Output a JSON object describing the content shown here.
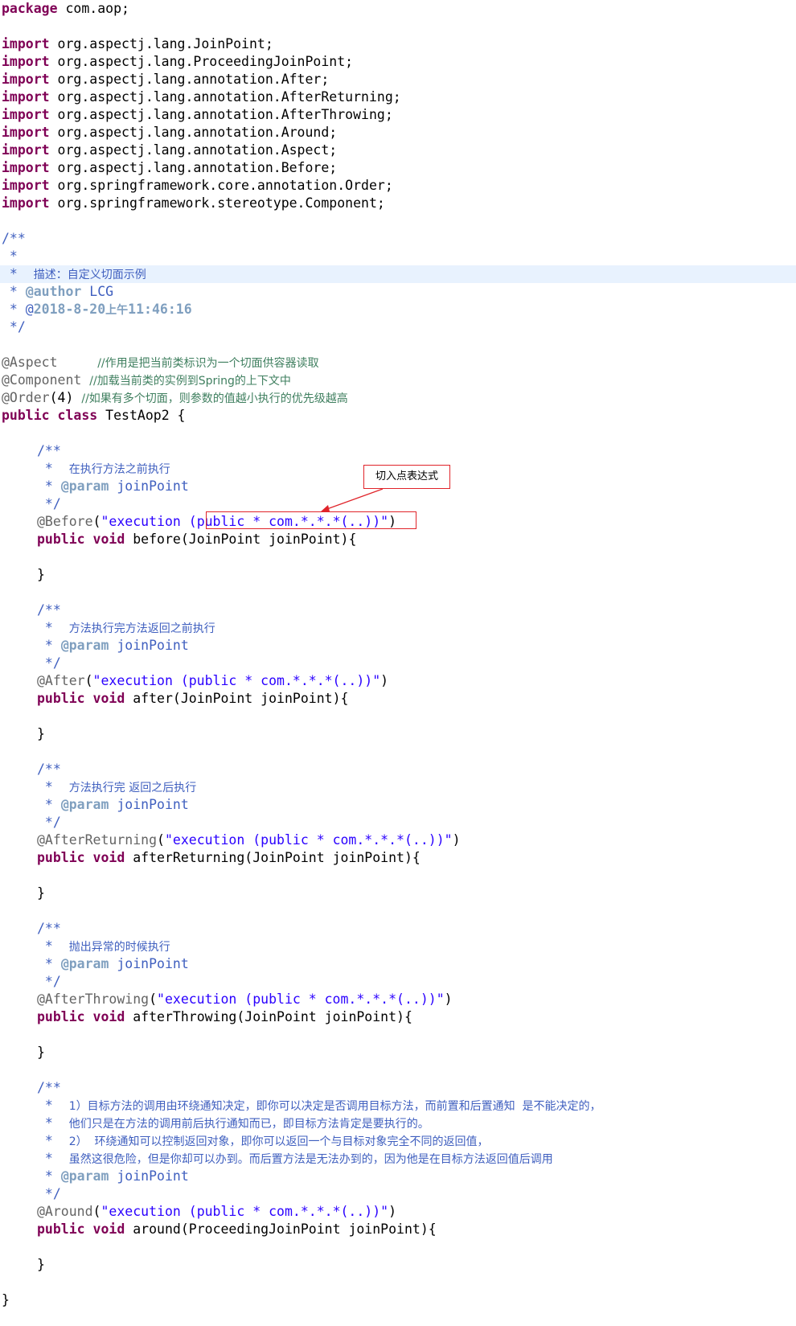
{
  "editor": {
    "lines": [
      {
        "indent": 0,
        "tokens": [
          {
            "t": "package",
            "c": "kw"
          },
          {
            "t": " com.aop;"
          }
        ]
      },
      {
        "indent": 0,
        "tokens": []
      },
      {
        "indent": 0,
        "tokens": [
          {
            "t": "import",
            "c": "kw"
          },
          {
            "t": " org.aspectj.lang.JoinPoint;"
          }
        ]
      },
      {
        "indent": 0,
        "tokens": [
          {
            "t": "import",
            "c": "kw"
          },
          {
            "t": " org.aspectj.lang.ProceedingJoinPoint;"
          }
        ]
      },
      {
        "indent": 0,
        "tokens": [
          {
            "t": "import",
            "c": "kw"
          },
          {
            "t": " org.aspectj.lang.annotation.After;"
          }
        ]
      },
      {
        "indent": 0,
        "tokens": [
          {
            "t": "import",
            "c": "kw"
          },
          {
            "t": " org.aspectj.lang.annotation.AfterReturning;"
          }
        ]
      },
      {
        "indent": 0,
        "tokens": [
          {
            "t": "import",
            "c": "kw"
          },
          {
            "t": " org.aspectj.lang.annotation.AfterThrowing;"
          }
        ]
      },
      {
        "indent": 0,
        "tokens": [
          {
            "t": "import",
            "c": "kw"
          },
          {
            "t": " org.aspectj.lang.annotation.Around;"
          }
        ]
      },
      {
        "indent": 0,
        "tokens": [
          {
            "t": "import",
            "c": "kw"
          },
          {
            "t": " org.aspectj.lang.annotation.Aspect;"
          }
        ]
      },
      {
        "indent": 0,
        "tokens": [
          {
            "t": "import",
            "c": "kw"
          },
          {
            "t": " org.aspectj.lang.annotation.Before;"
          }
        ]
      },
      {
        "indent": 0,
        "tokens": [
          {
            "t": "import",
            "c": "kw"
          },
          {
            "t": " org.springframework.core.annotation.Order;"
          }
        ]
      },
      {
        "indent": 0,
        "tokens": [
          {
            "t": "import",
            "c": "kw"
          },
          {
            "t": " org.springframework.stereotype.Component;"
          }
        ]
      },
      {
        "indent": 0,
        "tokens": []
      },
      {
        "indent": 0,
        "tokens": [
          {
            "t": "/**",
            "c": "com"
          }
        ]
      },
      {
        "indent": 0,
        "tokens": [
          {
            "t": " *",
            "c": "com"
          }
        ]
      },
      {
        "indent": 0,
        "hl": true,
        "tokens": [
          {
            "t": " *  ",
            "c": "com"
          },
          {
            "t": "描述：自定义切面示例",
            "c": "com",
            "cjk": true
          }
        ]
      },
      {
        "indent": 0,
        "tokens": [
          {
            "t": " * ",
            "c": "com"
          },
          {
            "t": "@author",
            "c": "tag"
          },
          {
            "t": " LCG",
            "c": "com"
          }
        ]
      },
      {
        "indent": 0,
        "tokens": [
          {
            "t": " * @",
            "c": "com"
          },
          {
            "t": "2018-8-20",
            "c": "tag"
          },
          {
            "t": "上午",
            "c": "tag",
            "cjk": true
          },
          {
            "t": "11:46:16",
            "c": "tag"
          }
        ]
      },
      {
        "indent": 0,
        "tokens": [
          {
            "t": " */",
            "c": "com"
          }
        ]
      },
      {
        "indent": 0,
        "tokens": []
      },
      {
        "indent": 0,
        "tokens": [
          {
            "t": "@Aspect",
            "c": "ann"
          },
          {
            "t": "     "
          },
          {
            "t": "//作用是把当前类标识为一个切面供容器读取",
            "c": "lcom",
            "cjk": true
          }
        ]
      },
      {
        "indent": 0,
        "tokens": [
          {
            "t": "@Component",
            "c": "ann"
          },
          {
            "t": " "
          },
          {
            "t": "//加载当前类的实例到Spring的上下文中",
            "c": "lcom",
            "cjk": true
          }
        ]
      },
      {
        "indent": 0,
        "tokens": [
          {
            "t": "@Order",
            "c": "ann"
          },
          {
            "t": "(4) "
          },
          {
            "t": "//如果有多个切面，则参数的值越小执行的优先级越高",
            "c": "lcom",
            "cjk": true
          }
        ]
      },
      {
        "indent": 0,
        "tokens": [
          {
            "t": "public",
            "c": "kw"
          },
          {
            "t": " "
          },
          {
            "t": "class",
            "c": "kw"
          },
          {
            "t": " TestAop2 {"
          }
        ]
      },
      {
        "indent": 0,
        "tokens": []
      },
      {
        "indent": 1,
        "tokens": [
          {
            "t": "/**",
            "c": "com"
          }
        ]
      },
      {
        "indent": 1,
        "tokens": [
          {
            "t": " *  ",
            "c": "com"
          },
          {
            "t": "在执行方法之前执行",
            "c": "com",
            "cjk": true
          }
        ]
      },
      {
        "indent": 1,
        "tokens": [
          {
            "t": " * ",
            "c": "com"
          },
          {
            "t": "@param",
            "c": "tag"
          },
          {
            "t": " joinPoint",
            "c": "com"
          }
        ]
      },
      {
        "indent": 1,
        "tokens": [
          {
            "t": " */",
            "c": "com"
          }
        ]
      },
      {
        "indent": 1,
        "tokens": [
          {
            "t": "@Before",
            "c": "ann"
          },
          {
            "t": "("
          },
          {
            "t": "\"execution (public * com.*.*.*(..))\"",
            "c": "str"
          },
          {
            "t": ")"
          }
        ]
      },
      {
        "indent": 1,
        "tokens": [
          {
            "t": "public",
            "c": "kw"
          },
          {
            "t": " "
          },
          {
            "t": "void",
            "c": "kw"
          },
          {
            "t": " before(JoinPoint joinPoint){"
          }
        ]
      },
      {
        "indent": 0,
        "tokens": []
      },
      {
        "indent": 1,
        "tokens": [
          {
            "t": "}"
          }
        ]
      },
      {
        "indent": 0,
        "tokens": []
      },
      {
        "indent": 1,
        "tokens": [
          {
            "t": "/**",
            "c": "com"
          }
        ]
      },
      {
        "indent": 1,
        "tokens": [
          {
            "t": " *  ",
            "c": "com"
          },
          {
            "t": "方法执行完方法返回之前执行",
            "c": "com",
            "cjk": true
          }
        ]
      },
      {
        "indent": 1,
        "tokens": [
          {
            "t": " * ",
            "c": "com"
          },
          {
            "t": "@param",
            "c": "tag"
          },
          {
            "t": " joinPoint",
            "c": "com"
          }
        ]
      },
      {
        "indent": 1,
        "tokens": [
          {
            "t": " */",
            "c": "com"
          }
        ]
      },
      {
        "indent": 1,
        "tokens": [
          {
            "t": "@After",
            "c": "ann"
          },
          {
            "t": "("
          },
          {
            "t": "\"execution (public * com.*.*.*(..))\"",
            "c": "str"
          },
          {
            "t": ")"
          }
        ]
      },
      {
        "indent": 1,
        "tokens": [
          {
            "t": "public",
            "c": "kw"
          },
          {
            "t": " "
          },
          {
            "t": "void",
            "c": "kw"
          },
          {
            "t": " after(JoinPoint joinPoint){"
          }
        ]
      },
      {
        "indent": 0,
        "tokens": []
      },
      {
        "indent": 1,
        "tokens": [
          {
            "t": "}"
          }
        ]
      },
      {
        "indent": 0,
        "tokens": []
      },
      {
        "indent": 1,
        "tokens": [
          {
            "t": "/**",
            "c": "com"
          }
        ]
      },
      {
        "indent": 1,
        "tokens": [
          {
            "t": " *  ",
            "c": "com"
          },
          {
            "t": "方法执行完 返回之后执行",
            "c": "com",
            "cjk": true
          }
        ]
      },
      {
        "indent": 1,
        "tokens": [
          {
            "t": " * ",
            "c": "com"
          },
          {
            "t": "@param",
            "c": "tag"
          },
          {
            "t": " joinPoint",
            "c": "com"
          }
        ]
      },
      {
        "indent": 1,
        "tokens": [
          {
            "t": " */",
            "c": "com"
          }
        ]
      },
      {
        "indent": 1,
        "tokens": [
          {
            "t": "@AfterReturning",
            "c": "ann"
          },
          {
            "t": "("
          },
          {
            "t": "\"execution (public * com.*.*.*(..))\"",
            "c": "str"
          },
          {
            "t": ")"
          }
        ]
      },
      {
        "indent": 1,
        "tokens": [
          {
            "t": "public",
            "c": "kw"
          },
          {
            "t": " "
          },
          {
            "t": "void",
            "c": "kw"
          },
          {
            "t": " afterReturning(JoinPoint joinPoint){"
          }
        ]
      },
      {
        "indent": 0,
        "tokens": []
      },
      {
        "indent": 1,
        "tokens": [
          {
            "t": "}"
          }
        ]
      },
      {
        "indent": 0,
        "tokens": []
      },
      {
        "indent": 1,
        "tokens": [
          {
            "t": "/**",
            "c": "com"
          }
        ]
      },
      {
        "indent": 1,
        "tokens": [
          {
            "t": " *  ",
            "c": "com"
          },
          {
            "t": "抛出异常的时候执行",
            "c": "com",
            "cjk": true
          }
        ]
      },
      {
        "indent": 1,
        "tokens": [
          {
            "t": " * ",
            "c": "com"
          },
          {
            "t": "@param",
            "c": "tag"
          },
          {
            "t": " joinPoint",
            "c": "com"
          }
        ]
      },
      {
        "indent": 1,
        "tokens": [
          {
            "t": " */",
            "c": "com"
          }
        ]
      },
      {
        "indent": 1,
        "tokens": [
          {
            "t": "@AfterThrowing",
            "c": "ann"
          },
          {
            "t": "("
          },
          {
            "t": "\"execution (public * com.*.*.*(..))\"",
            "c": "str"
          },
          {
            "t": ")"
          }
        ]
      },
      {
        "indent": 1,
        "tokens": [
          {
            "t": "public",
            "c": "kw"
          },
          {
            "t": " "
          },
          {
            "t": "void",
            "c": "kw"
          },
          {
            "t": " afterThrowing(JoinPoint joinPoint){"
          }
        ]
      },
      {
        "indent": 0,
        "tokens": []
      },
      {
        "indent": 1,
        "tokens": [
          {
            "t": "}"
          }
        ]
      },
      {
        "indent": 0,
        "tokens": []
      },
      {
        "indent": 1,
        "tokens": [
          {
            "t": "/**",
            "c": "com"
          }
        ]
      },
      {
        "indent": 1,
        "tokens": [
          {
            "t": " *  ",
            "c": "com"
          },
          {
            "t": "1）目标方法的调用由环绕通知决定，即你可以决定是否调用目标方法，而前置和后置通知  是不能决定的，",
            "c": "com",
            "cjk": true
          }
        ]
      },
      {
        "indent": 1,
        "tokens": [
          {
            "t": " *  ",
            "c": "com"
          },
          {
            "t": "他们只是在方法的调用前后执行通知而已，即目标方法肯定是要执行的。",
            "c": "com",
            "cjk": true
          }
        ]
      },
      {
        "indent": 1,
        "tokens": [
          {
            "t": " *  ",
            "c": "com"
          },
          {
            "t": "2）  环绕通知可以控制返回对象，即你可以返回一个与目标对象完全不同的返回值，",
            "c": "com",
            "cjk": true
          }
        ]
      },
      {
        "indent": 1,
        "tokens": [
          {
            "t": " *  ",
            "c": "com"
          },
          {
            "t": "虽然这很危险，但是你却可以办到。而后置方法是无法办到的，因为他是在目标方法返回值后调用",
            "c": "com",
            "cjk": true
          }
        ]
      },
      {
        "indent": 1,
        "tokens": [
          {
            "t": " * ",
            "c": "com"
          },
          {
            "t": "@param",
            "c": "tag"
          },
          {
            "t": " joinPoint",
            "c": "com"
          }
        ]
      },
      {
        "indent": 1,
        "tokens": [
          {
            "t": " */",
            "c": "com"
          }
        ]
      },
      {
        "indent": 1,
        "tokens": [
          {
            "t": "@Around",
            "c": "ann"
          },
          {
            "t": "("
          },
          {
            "t": "\"execution (public * com.*.*.*(..))\"",
            "c": "str"
          },
          {
            "t": ")"
          }
        ]
      },
      {
        "indent": 1,
        "tokens": [
          {
            "t": "public",
            "c": "kw"
          },
          {
            "t": " "
          },
          {
            "t": "void",
            "c": "kw"
          },
          {
            "t": " around(ProceedingJoinPoint joinPoint){"
          }
        ]
      },
      {
        "indent": 0,
        "tokens": []
      },
      {
        "indent": 1,
        "tokens": [
          {
            "t": "}"
          }
        ]
      },
      {
        "indent": 0,
        "tokens": []
      },
      {
        "indent": 0,
        "tokens": [
          {
            "t": "}"
          }
        ]
      }
    ]
  },
  "callout": {
    "label": "切入点表达式",
    "border_color": "#e0242a"
  },
  "colors": {
    "keyword": "#7f0055",
    "string": "#2a00ff",
    "annotation": "#646464",
    "javadoc": "#3f5fbf",
    "javadoc_tag": "#7f9fbf",
    "line_comment": "#3f7f5f",
    "current_line": "#e8f2fe"
  }
}
